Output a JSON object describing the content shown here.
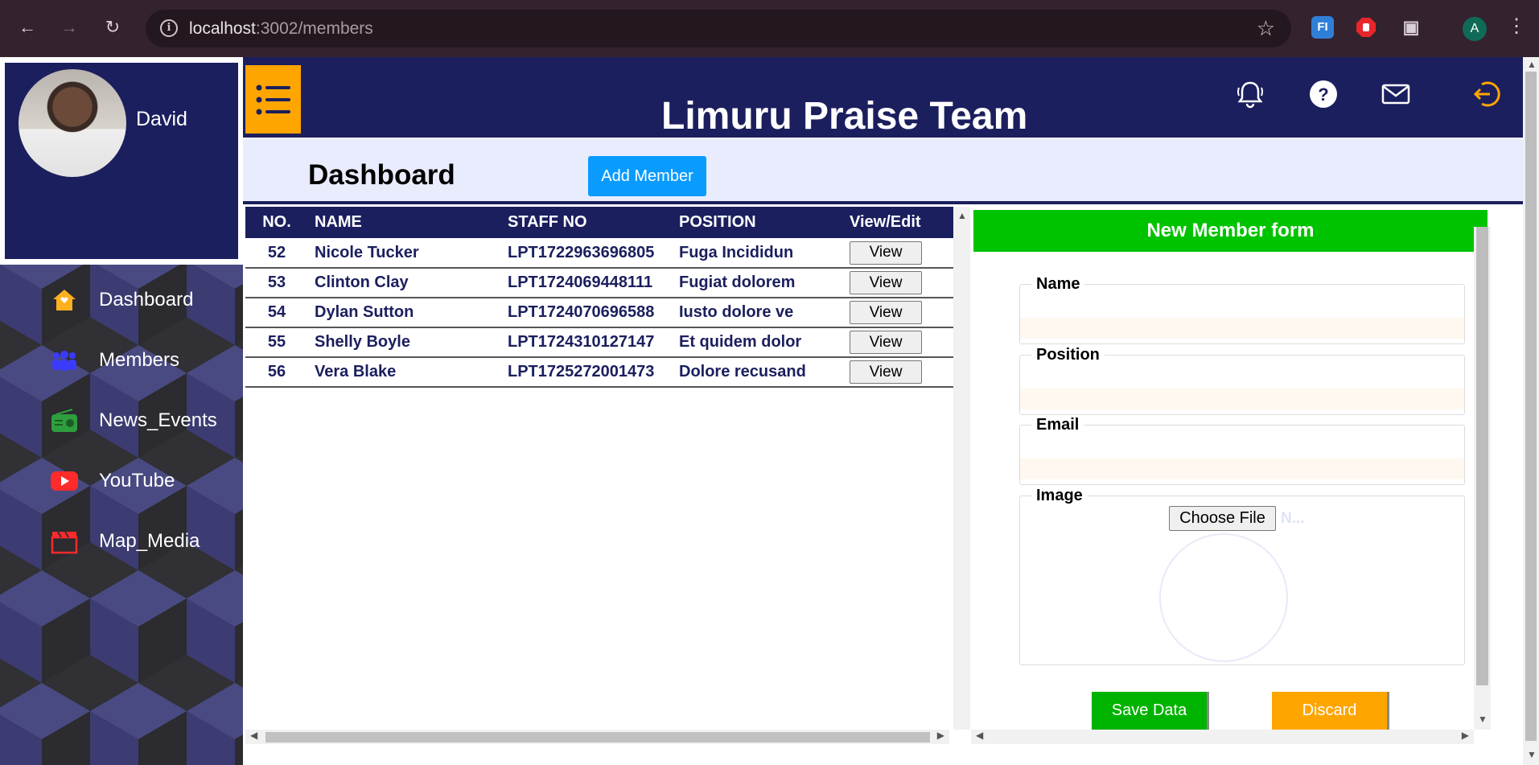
{
  "browser": {
    "url_host": "localhost",
    "url_path": ":3002/members",
    "profile_initial": "A",
    "ext1_label": "FI"
  },
  "profile": {
    "name": "David"
  },
  "sidebar": {
    "items": [
      {
        "label": "Dashboard",
        "icon": "home-icon",
        "color": "#ffb020"
      },
      {
        "label": "Members",
        "icon": "users-icon",
        "color": "#3b3bff"
      },
      {
        "label": "News_Events",
        "icon": "radio-icon",
        "color": "#2e9e3e"
      },
      {
        "label": "YouTube",
        "icon": "youtube-icon",
        "color": "#ff2a2a"
      },
      {
        "label": "Map_Media",
        "icon": "clapperboard-icon",
        "color": "#ff2a2a"
      }
    ]
  },
  "header": {
    "title": "Limuru Praise Team"
  },
  "dashbar": {
    "title": "Dashboard",
    "add_member_label": "Add Member"
  },
  "table": {
    "columns": [
      "NO.",
      "NAME",
      "STAFF NO",
      "POSITION",
      "View/Edit"
    ],
    "rows": [
      {
        "no": "52",
        "name": "Nicole Tucker",
        "staff_no": "LPT1722963696805",
        "position": "Fuga Incididun",
        "action": "View"
      },
      {
        "no": "53",
        "name": "Clinton Clay",
        "staff_no": "LPT1724069448111",
        "position": "Fugiat dolorem",
        "action": "View"
      },
      {
        "no": "54",
        "name": "Dylan Sutton",
        "staff_no": "LPT1724070696588",
        "position": "Iusto dolore ve",
        "action": "View"
      },
      {
        "no": "55",
        "name": "Shelly Boyle",
        "staff_no": "LPT1724310127147",
        "position": "Et quidem dolor",
        "action": "View"
      },
      {
        "no": "56",
        "name": "Vera Blake",
        "staff_no": "LPT1725272001473",
        "position": "Dolore recusand",
        "action": "View"
      }
    ]
  },
  "form": {
    "title": "New Member form",
    "name_label": "Name",
    "position_label": "Position",
    "email_label": "Email",
    "image_label": "Image",
    "choose_file_label": "Choose File",
    "no_file_text": "N...",
    "save_label": "Save Data",
    "discard_label": "Discard"
  },
  "colors": {
    "navy": "#1b1f5e",
    "accent_orange": "#ffa500",
    "form_green": "#00c300",
    "button_blue": "#0a9bff"
  }
}
